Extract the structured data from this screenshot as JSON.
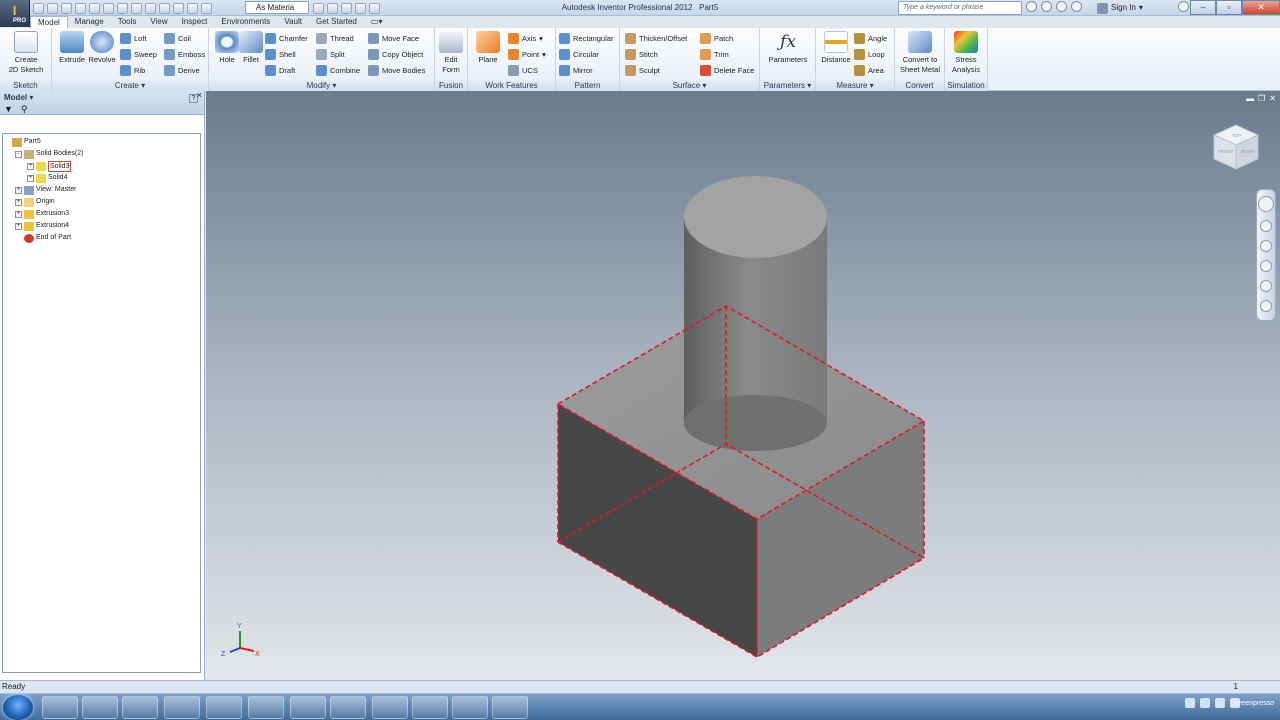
{
  "window": {
    "title": "Autodesk Inventor Professional 2012",
    "document": "Part5",
    "keyword_search_placeholder": "Type a keyword or phrase",
    "sign_in": "Sign In",
    "app_badge": "PRO",
    "material_selector": "As Materia"
  },
  "tabs": [
    "Model",
    "Manage",
    "Tools",
    "View",
    "Inspect",
    "Environments",
    "Vault",
    "Get Started"
  ],
  "active_tab": "Model",
  "ribbon": {
    "sketch": {
      "label": "Sketch",
      "create_2d": "Create",
      "create_2d_2": "2D Sketch"
    },
    "create": {
      "label": "Create",
      "extrude": "Extrude",
      "revolve": "Revolve",
      "loft": "Loft",
      "sweep": "Sweep",
      "rib": "Rib",
      "coil": "Coil",
      "emboss": "Emboss",
      "derive": "Derive"
    },
    "modify": {
      "label": "Modify",
      "hole": "Hole",
      "fillet": "Fillet",
      "chamfer": "Chamfer",
      "shell": "Shell",
      "draft": "Draft",
      "thread": "Thread",
      "split": "Split",
      "combine": "Combine",
      "move_face": "Move Face",
      "copy_object": "Copy Object",
      "move_bodies": "Move Bodies"
    },
    "fusion": {
      "label": "Fusion",
      "edit_form": "Edit",
      "edit_form_2": "Form"
    },
    "work_features": {
      "label": "Work Features",
      "plane": "Plane",
      "axis": "Axis",
      "point": "Point",
      "ucs": "UCS"
    },
    "pattern": {
      "label": "Pattern",
      "rectangular": "Rectangular",
      "circular": "Circular",
      "mirror": "Mirror"
    },
    "surface": {
      "label": "Surface",
      "thicken": "Thicken/Offset",
      "stitch": "Stitch",
      "sculpt": "Sculpt",
      "patch": "Patch",
      "trim": "Trim",
      "delete_face": "Delete Face"
    },
    "parameters": {
      "label": "Parameters",
      "parameters": "Parameters"
    },
    "measure": {
      "label": "Measure",
      "distance": "Distance",
      "angle": "Angle",
      "loop": "Loop",
      "area": "Area"
    },
    "convert": {
      "label": "Convert",
      "sheet_metal": "Convert to",
      "sheet_metal_2": "Sheet Metal"
    },
    "simulation": {
      "label": "Simulation",
      "stress": "Stress",
      "stress_2": "Analysis"
    }
  },
  "browser": {
    "header": "Model",
    "tree": [
      {
        "label": "Part5",
        "level": 0,
        "icon": "part-icon"
      },
      {
        "label": "Solid Bodies(2)",
        "level": 1,
        "icon": "solid-bodies-icon",
        "expander": "-"
      },
      {
        "label": "Solid3",
        "level": 2,
        "icon": "solid-body-icon",
        "expander": "+",
        "selected": true
      },
      {
        "label": "Solid4",
        "level": 2,
        "icon": "solid-body-icon",
        "expander": "+"
      },
      {
        "label": "View: Master",
        "level": 1,
        "icon": "view-icon",
        "expander": "+"
      },
      {
        "label": "Origin",
        "level": 1,
        "icon": "folder-icon",
        "expander": "+"
      },
      {
        "label": "Extrusion3",
        "level": 1,
        "icon": "extrusion-icon",
        "expander": "+"
      },
      {
        "label": "Extrusion4",
        "level": 1,
        "icon": "extrusion-icon",
        "expander": "+"
      },
      {
        "label": "End of Part",
        "level": 1,
        "icon": "end-of-part-icon"
      }
    ]
  },
  "viewcube": {
    "top": "TOP",
    "front": "FRONT",
    "right": "RIGHT"
  },
  "triad": {
    "x": "X",
    "y": "Y",
    "z": "Z"
  },
  "status": {
    "text": "Ready",
    "right_a": "1",
    "right_b": "1"
  },
  "taskbar": {
    "watermark": "Screenpresso"
  },
  "colors": {
    "selection_red": "#e0191f",
    "ribbon_bg": "#e7eef7",
    "viewport_top": "#6b7a8c",
    "viewport_bottom": "#e3e6ea"
  }
}
